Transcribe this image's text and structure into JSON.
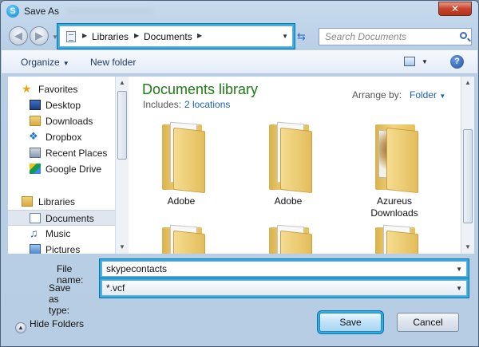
{
  "window": {
    "title": "Save As"
  },
  "address": {
    "crumbs": [
      "Libraries",
      "Documents"
    ]
  },
  "search": {
    "placeholder": "Search Documents"
  },
  "toolbar": {
    "organize": "Organize",
    "new_folder": "New folder"
  },
  "nav": {
    "favorites_label": "Favorites",
    "favorites": [
      "Desktop",
      "Downloads",
      "Dropbox",
      "Recent Places",
      "Google Drive"
    ],
    "libraries_label": "Libraries",
    "libraries": [
      "Documents",
      "Music",
      "Pictures"
    ],
    "selected": "Documents"
  },
  "library": {
    "title": "Documents library",
    "includes_label": "Includes:",
    "includes_link": "2 locations",
    "arrange_label": "Arrange by:",
    "arrange_value": "Folder"
  },
  "folders": [
    {
      "label": "Adobe"
    },
    {
      "label": "Adobe"
    },
    {
      "label": "Azureus Downloads"
    },
    {
      "label": ""
    },
    {
      "label": ""
    },
    {
      "label": ""
    }
  ],
  "form": {
    "filename_label": "File name:",
    "filename_value": "skypecontacts",
    "filetype_label": "Save as type:",
    "filetype_value": "*.vcf"
  },
  "footer": {
    "hide_folders": "Hide Folders",
    "save": "Save",
    "cancel": "Cancel"
  },
  "colors": {
    "accent": "#1fb6e9",
    "library_title": "#1e7a14",
    "link": "#1f5fb7"
  }
}
